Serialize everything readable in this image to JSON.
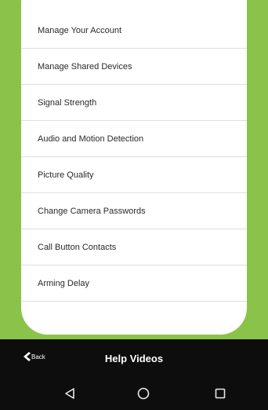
{
  "menu": {
    "items": [
      {
        "label": "Manage Your Account"
      },
      {
        "label": "Manage Shared Devices"
      },
      {
        "label": "Signal Strength"
      },
      {
        "label": "Audio and Motion Detection"
      },
      {
        "label": "Picture Quality"
      },
      {
        "label": "Change Camera Passwords"
      },
      {
        "label": "Call Button Contacts"
      },
      {
        "label": "Arming Delay"
      }
    ]
  },
  "header": {
    "back_label": "Back",
    "title": "Help Videos"
  },
  "android_nav": {
    "back_icon": "triangle-back-icon",
    "home_icon": "circle-home-icon",
    "recents_icon": "square-recents-icon"
  },
  "colors": {
    "accent_green": "#8bc34a",
    "bar_black": "#0d0d0d",
    "card_white": "#ffffff"
  }
}
